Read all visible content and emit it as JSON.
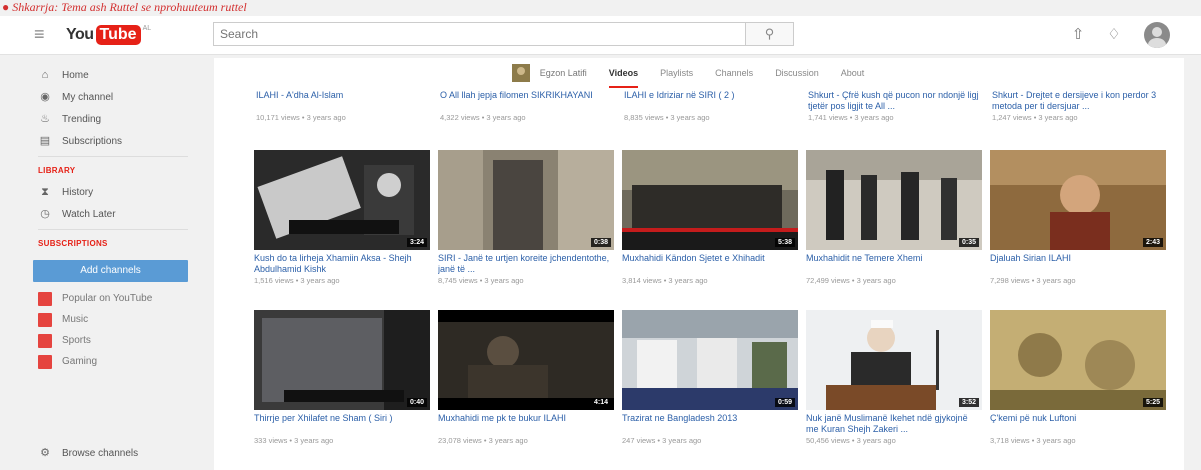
{
  "caption": {
    "bullet": "●",
    "text": "Shkarrja: Tema ash Ruttel se nprohuuteum ruttel"
  },
  "topbar": {
    "logo_you": "You",
    "logo_tube": "Tube",
    "logo_sup": "AL",
    "search_placeholder": "Search",
    "icons": [
      "upload-icon",
      "bell-icon",
      "account-icon"
    ]
  },
  "sidebar": {
    "nav": [
      {
        "label": "Home",
        "icon": "⌂"
      },
      {
        "label": "My channel",
        "icon": "◉"
      },
      {
        "label": "Trending",
        "icon": "♨"
      },
      {
        "label": "Subscriptions",
        "icon": "▤"
      }
    ],
    "library_heading": "LIBRARY",
    "library": [
      {
        "label": "History",
        "icon": "⧗"
      },
      {
        "label": "Watch Later",
        "icon": "◷"
      }
    ],
    "subs_heading": "SUBSCRIPTIONS",
    "add_channels": "Add channels",
    "subs": [
      {
        "label": "Popular on YouTube"
      },
      {
        "label": "Music"
      },
      {
        "label": "Sports"
      },
      {
        "label": "Gaming"
      }
    ],
    "browse": {
      "label": "Browse channels",
      "icon": "⚙"
    }
  },
  "channel": {
    "name": "Egzon Latifi",
    "tabs": [
      "Videos",
      "Playlists",
      "Channels",
      "Discussion",
      "About"
    ],
    "active_tab": "Videos"
  },
  "row0": [
    {
      "title": "ILAHI - A'dha Al-Islam",
      "meta": "10,171 views • 3 years ago"
    },
    {
      "title": "O All llah jepja filomen SIKRIKHAYANI",
      "meta": "4,322 views • 3 years ago"
    },
    {
      "title": "ILAHI e Idriziar në SIRI ( 2 )",
      "meta": "8,835 views • 3 years ago"
    },
    {
      "title": "Shkurt - Çfrë kush që pucon nor ndonjë ligj tjetër pos ligjit te All ...",
      "meta": "1,741 views • 3 years ago"
    },
    {
      "title": "Shkurt - Drejtet e dersijeve i kon perdor 3 metoda per ti dersjuar ...",
      "meta": "1,247 views • 3 years ago"
    }
  ],
  "row1": [
    {
      "title": "Kush do ta lirheja Xhamiin Aksa - Shejh Abdulhamid Kishk",
      "meta": "1,516 views • 3 years ago",
      "duration": "3:24"
    },
    {
      "title": "SIRI - Janë te urtjen koreite jchendentothe, janë të ...",
      "meta": "8,745 views • 3 years ago",
      "duration": "0:38"
    },
    {
      "title": "Muxhahidi Kändon Sjetet e Xhihadit",
      "meta": "3,814 views • 3 years ago",
      "duration": "5:38"
    },
    {
      "title": "Muxhahidit ne Temere Xhemi",
      "meta": "72,499 views • 3 years ago",
      "duration": "0:35"
    },
    {
      "title": "Djaluah Sirian ILAHI",
      "meta": "7,298 views • 3 years ago",
      "duration": "2:43"
    }
  ],
  "row2": [
    {
      "title": "Thirrje per Xhilafet ne Sham ( Siri )",
      "meta": "333 views • 3 years ago",
      "duration": "0:40"
    },
    {
      "title": "Muxhahidi me pk te bukur ILAHI",
      "meta": "23,078 views • 3 years ago",
      "duration": "4:14"
    },
    {
      "title": "Trazirat ne Bangladesh 2013",
      "meta": "247 views • 3 years ago",
      "duration": "0:59"
    },
    {
      "title": "Nuk janë Muslimanë Ikehet ndë gjykojnë me Kuran Shejh Zakeri ...",
      "meta": "50,456 views • 3 years ago",
      "duration": "3:52"
    },
    {
      "title": "Ç'kemi pë nuk Luftoni",
      "meta": "3,718 views • 3 years ago",
      "duration": "5:25"
    }
  ]
}
